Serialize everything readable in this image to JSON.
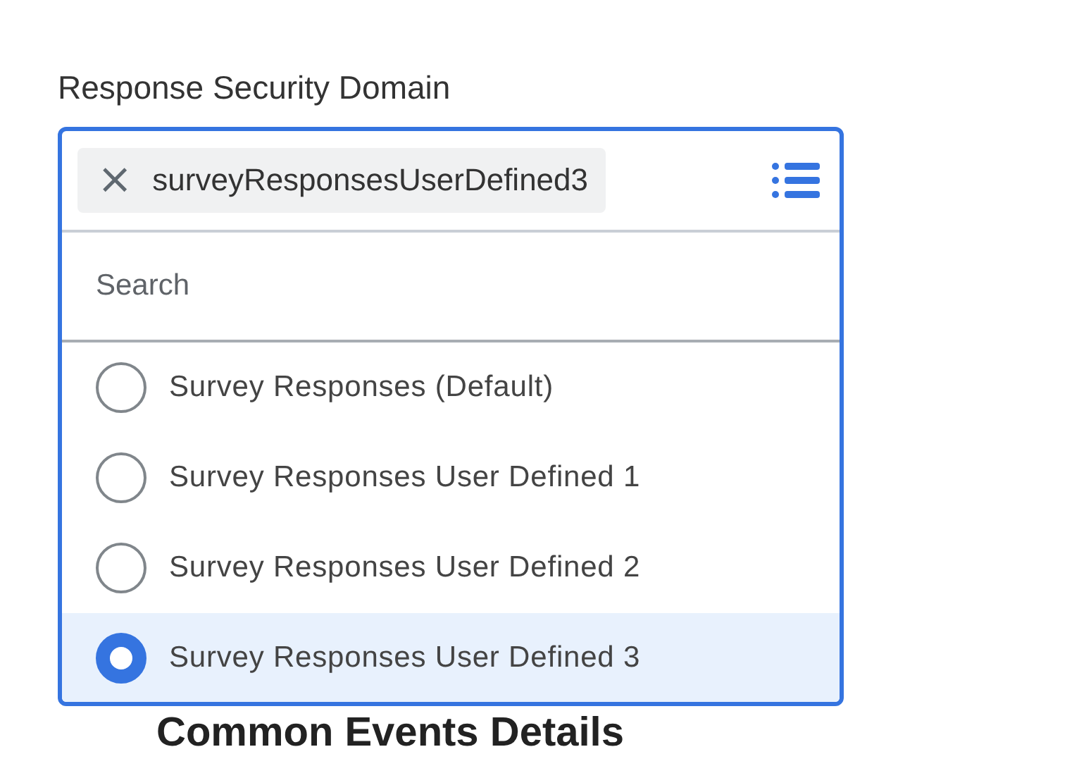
{
  "field": {
    "label": "Response Security Domain",
    "chip": {
      "remove": "×",
      "value": "surveyResponsesUserDefined3"
    },
    "search": {
      "placeholder": "Search"
    },
    "options": [
      {
        "label": "Survey Responses (Default)",
        "selected": false
      },
      {
        "label": "Survey Responses User Defined 1",
        "selected": false
      },
      {
        "label": "Survey Responses User Defined 2",
        "selected": false
      },
      {
        "label": "Survey Responses User Defined 3",
        "selected": true
      }
    ]
  },
  "background_heading": "Common Events Details"
}
